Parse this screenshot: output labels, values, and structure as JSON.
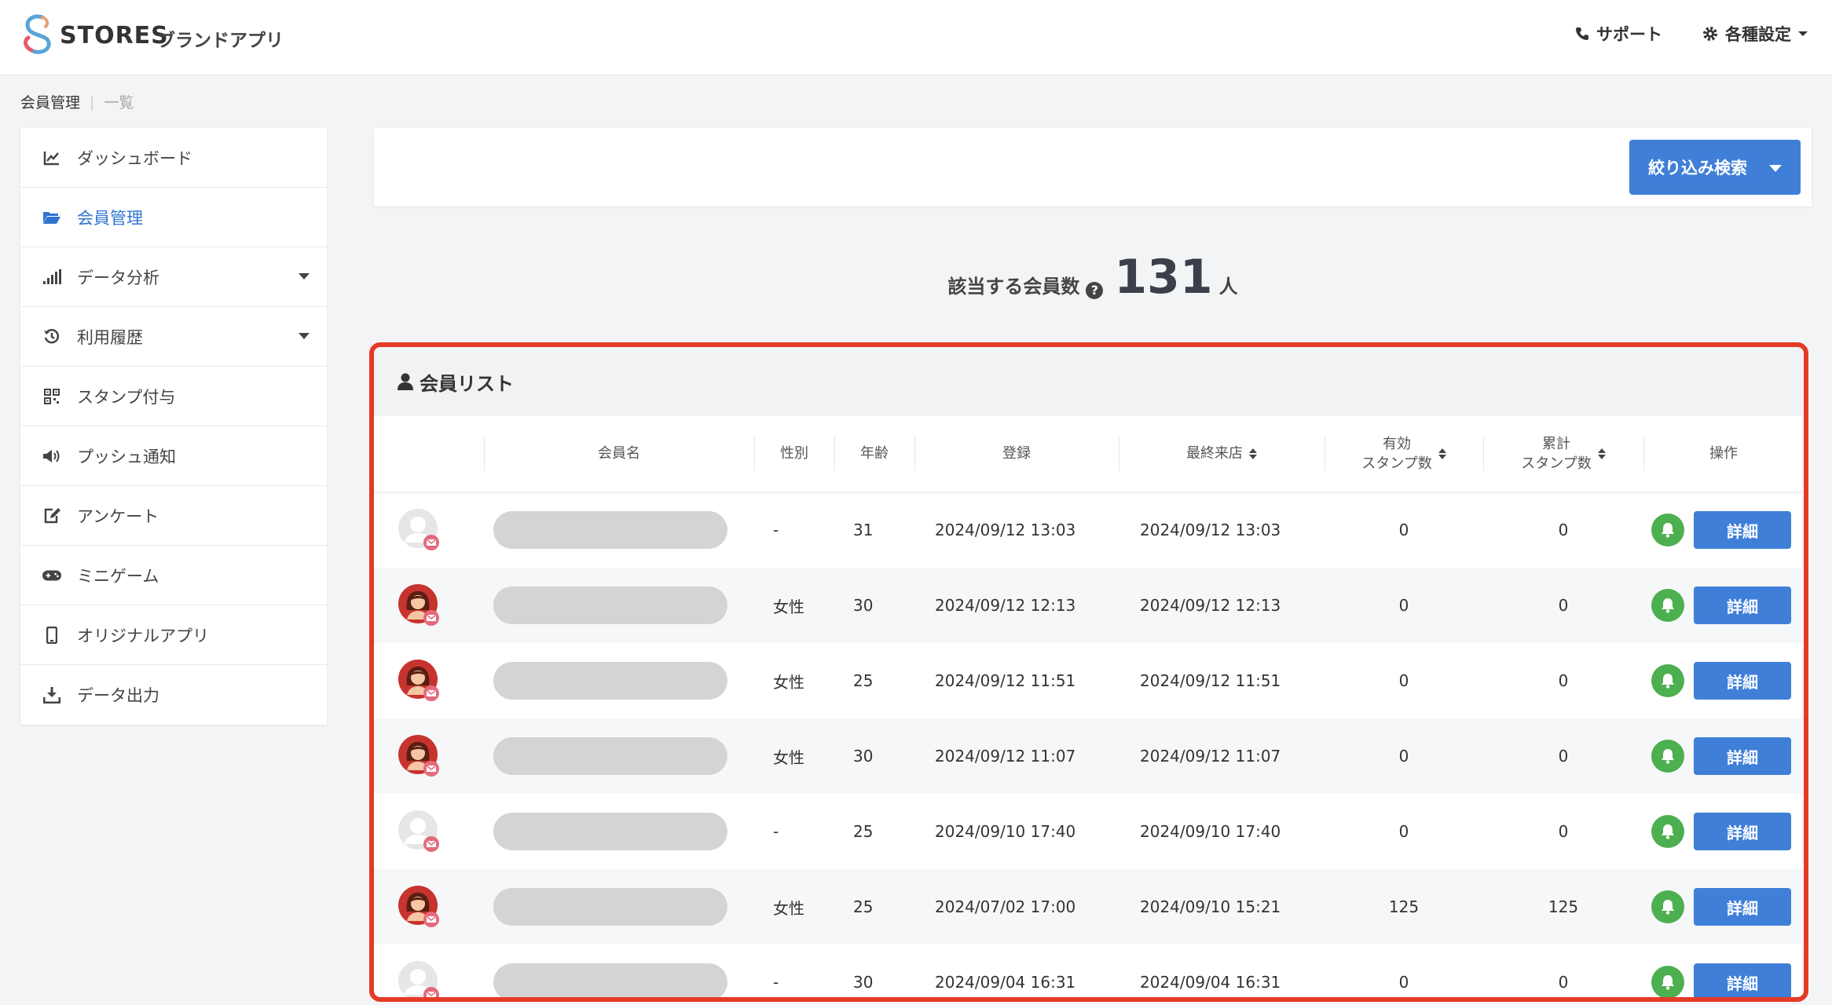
{
  "header": {
    "brand": "STORES",
    "brand_sub": "ブランドアプリ",
    "support_label": "サポート",
    "settings_label": "各種設定"
  },
  "breadcrumb": {
    "current": "会員管理",
    "separator": "|",
    "sub": "一覧"
  },
  "sidebar": {
    "items": [
      {
        "label": "ダッシュボード",
        "icon": "chart-line-icon"
      },
      {
        "label": "会員管理",
        "icon": "folder-open-icon",
        "active": true
      },
      {
        "label": "データ分析",
        "icon": "signal-bars-icon",
        "has_submenu": true
      },
      {
        "label": "利用履歴",
        "icon": "history-icon",
        "has_submenu": true
      },
      {
        "label": "スタンプ付与",
        "icon": "qrcode-icon"
      },
      {
        "label": "プッシュ通知",
        "icon": "megaphone-icon"
      },
      {
        "label": "アンケート",
        "icon": "edit-icon"
      },
      {
        "label": "ミニゲーム",
        "icon": "gamepad-icon"
      },
      {
        "label": "オリジナルアプリ",
        "icon": "mobile-icon"
      },
      {
        "label": "データ出力",
        "icon": "download-icon"
      }
    ]
  },
  "filter": {
    "button_label": "絞り込み検索"
  },
  "count": {
    "label": "該当する会員数",
    "help": "?",
    "value": "131",
    "unit": "人"
  },
  "member_list": {
    "title": "会員リスト",
    "columns": {
      "name": "会員名",
      "gender": "性別",
      "age": "年齢",
      "registered": "登録",
      "last_visit": "最終来店",
      "valid_stamps_1": "有効",
      "valid_stamps_2": "スタンプ数",
      "total_stamps_1": "累計",
      "total_stamps_2": "スタンプ数",
      "actions": "操作"
    },
    "detail_label": "詳細",
    "rows": [
      {
        "avatar": "default",
        "gender": "-",
        "age": "31",
        "registered": "2024/09/12 13:03",
        "last_visit": "2024/09/12 13:03",
        "valid": "0",
        "total": "0"
      },
      {
        "avatar": "female",
        "gender": "女性",
        "age": "30",
        "registered": "2024/09/12 12:13",
        "last_visit": "2024/09/12 12:13",
        "valid": "0",
        "total": "0"
      },
      {
        "avatar": "female",
        "gender": "女性",
        "age": "25",
        "registered": "2024/09/12 11:51",
        "last_visit": "2024/09/12 11:51",
        "valid": "0",
        "total": "0"
      },
      {
        "avatar": "female",
        "gender": "女性",
        "age": "30",
        "registered": "2024/09/12 11:07",
        "last_visit": "2024/09/12 11:07",
        "valid": "0",
        "total": "0"
      },
      {
        "avatar": "default",
        "gender": "-",
        "age": "25",
        "registered": "2024/09/10 17:40",
        "last_visit": "2024/09/10 17:40",
        "valid": "0",
        "total": "0"
      },
      {
        "avatar": "female",
        "gender": "女性",
        "age": "25",
        "registered": "2024/07/02 17:00",
        "last_visit": "2024/09/10 15:21",
        "valid": "125",
        "total": "125"
      },
      {
        "avatar": "default",
        "gender": "-",
        "age": "30",
        "registered": "2024/09/04 16:31",
        "last_visit": "2024/09/04 16:31",
        "valid": "0",
        "total": "0"
      }
    ]
  },
  "colors": {
    "accent": "#3f7fd8",
    "highlight_border": "#e53a26",
    "bell_green": "#4caf50",
    "active_nav": "#2f74d0"
  }
}
